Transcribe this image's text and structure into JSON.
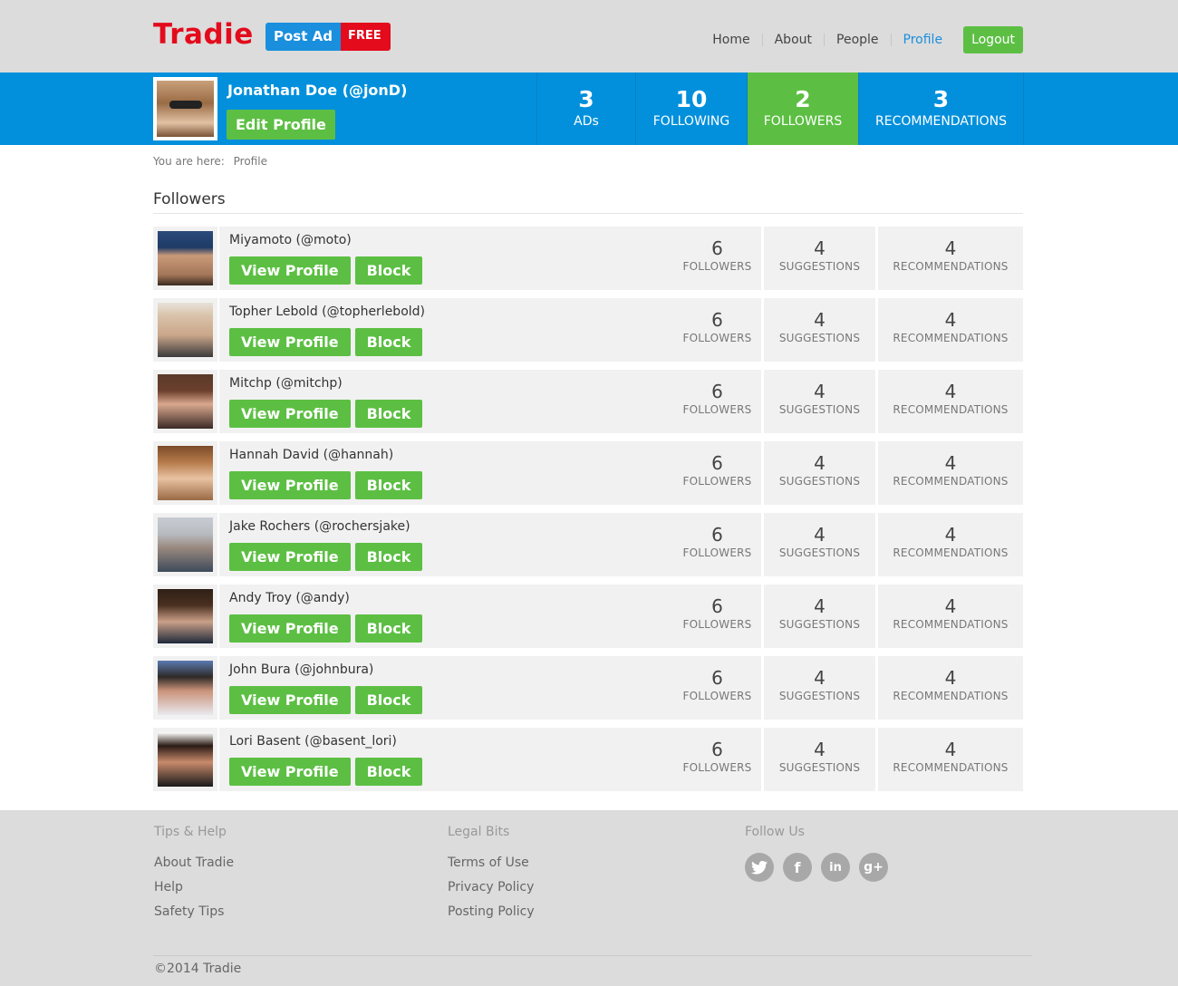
{
  "header": {
    "logo": "Tradie",
    "post_ad": "Post Ad",
    "free": "FREE",
    "nav": [
      "Home",
      "About",
      "People",
      "Profile"
    ],
    "logout": "Logout"
  },
  "profile": {
    "name": "Jonathan Doe (@jonD)",
    "edit_label": "Edit Profile",
    "stats": [
      {
        "value": "3",
        "label": "ADs"
      },
      {
        "value": "10",
        "label": "FOLLOWING"
      },
      {
        "value": "2",
        "label": "FOLLOWERS"
      },
      {
        "value": "3",
        "label": "RECOMMENDATIONS"
      }
    ]
  },
  "breadcrumb": {
    "prefix": "You are here:",
    "current": "Profile"
  },
  "section_title": "Followers",
  "buttons": {
    "view": "View Profile",
    "block": "Block"
  },
  "stat_labels": {
    "followers": "FOLLOWERS",
    "suggestions": "SUGGESTIONS",
    "recommendations": "RECOMMENDATIONS"
  },
  "followers": [
    {
      "name": "Miyamoto (@moto)",
      "followers": "6",
      "suggestions": "4",
      "recommendations": "4"
    },
    {
      "name": "Topher Lebold (@topherlebold)",
      "followers": "6",
      "suggestions": "4",
      "recommendations": "4"
    },
    {
      "name": "Mitchp (@mitchp)",
      "followers": "6",
      "suggestions": "4",
      "recommendations": "4"
    },
    {
      "name": "Hannah David (@hannah)",
      "followers": "6",
      "suggestions": "4",
      "recommendations": "4"
    },
    {
      "name": "Jake Rochers  (@rochersjake)",
      "followers": "6",
      "suggestions": "4",
      "recommendations": "4"
    },
    {
      "name": "Andy Troy (@andy)",
      "followers": "6",
      "suggestions": "4",
      "recommendations": "4"
    },
    {
      "name": "John Bura (@johnbura)",
      "followers": "6",
      "suggestions": "4",
      "recommendations": "4"
    },
    {
      "name": "Lori Basent (@basent_lori)",
      "followers": "6",
      "suggestions": "4",
      "recommendations": "4"
    }
  ],
  "footer": {
    "tips": {
      "heading": "Tips & Help",
      "links": [
        "About Tradie",
        "Help",
        "Safety Tips"
      ]
    },
    "legal": {
      "heading": "Legal Bits",
      "links": [
        "Terms of Use",
        "Privacy Policy",
        "Posting Policy"
      ]
    },
    "follow": {
      "heading": "Follow Us",
      "icons": [
        "twitter-icon",
        "facebook-icon",
        "linkedin-icon",
        "google-plus-icon"
      ]
    },
    "copyright": "©2014 Tradie"
  },
  "colors": {
    "brand_red": "#e30b1c",
    "blue": "#0290dc",
    "green": "#5cbf43"
  }
}
